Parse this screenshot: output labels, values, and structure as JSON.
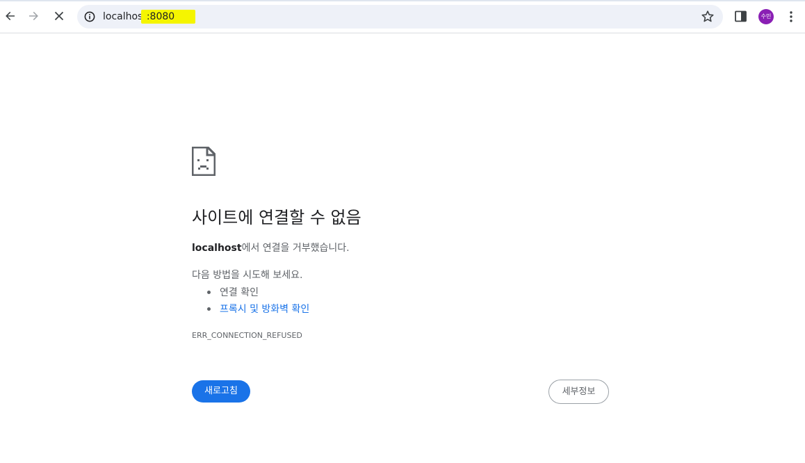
{
  "browser": {
    "url_host": "localhost",
    "url_port": ":8080",
    "profile_initials": "수민",
    "icons": {
      "back": "back-arrow-icon",
      "forward": "forward-arrow-icon",
      "stop": "close-icon",
      "site_info": "info-icon",
      "bookmark": "star-icon",
      "side_panel": "side-panel-icon",
      "menu": "kebab-menu-icon"
    },
    "highlight_color": "#f5f500"
  },
  "error_page": {
    "icon": "sad-page-icon",
    "title": "사이트에 연결할 수 없음",
    "host_bold": "localhost",
    "description_rest": "에서 연결을 거부했습니다.",
    "try_label": "다음 방법을 시도해 보세요.",
    "suggestions": [
      {
        "label": "연결 확인",
        "is_link": false
      },
      {
        "label": "프록시 및 방화벽 확인",
        "is_link": true
      }
    ],
    "error_code": "ERR_CONNECTION_REFUSED",
    "reload_label": "새로고침",
    "details_label": "세부정보",
    "accent_color": "#1a73e8"
  }
}
